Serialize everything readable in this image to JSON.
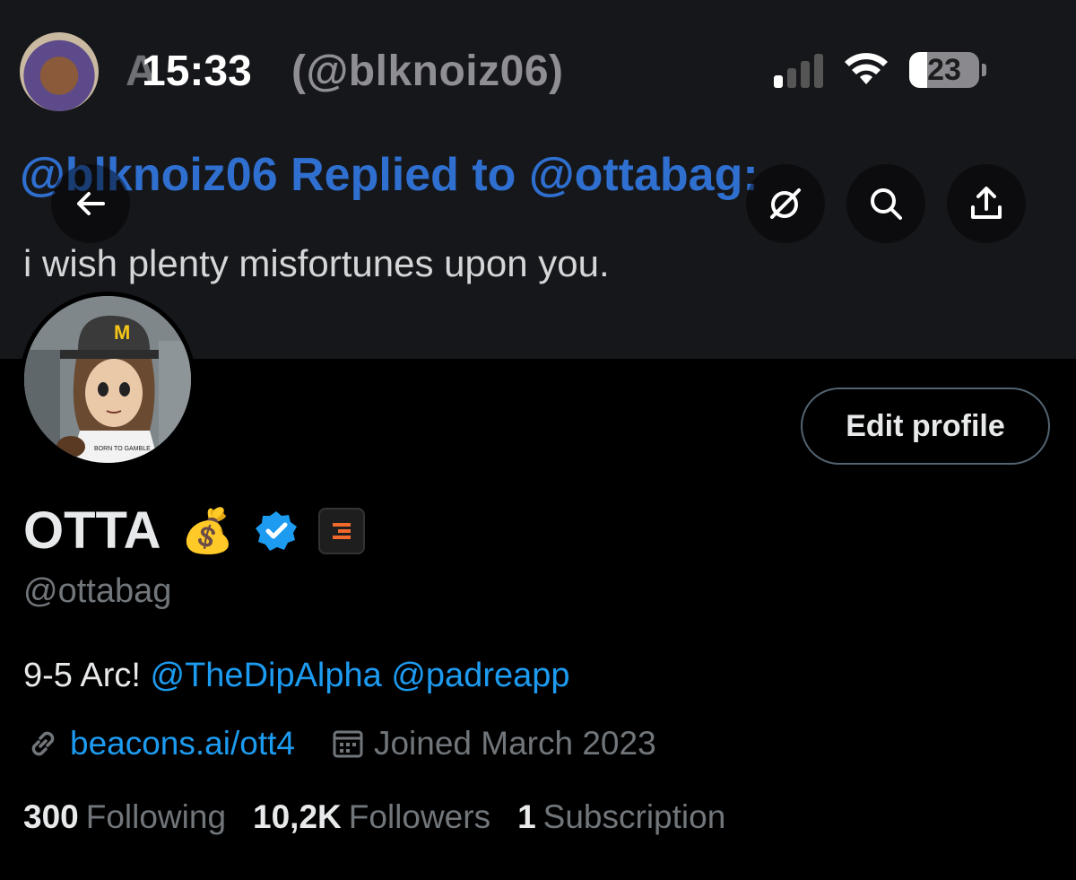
{
  "banner": {
    "title_ghost": "A",
    "title_handle": "(@blknoiz06)",
    "reply_line": "@blknoiz06 Replied to @ottabag:",
    "reply_text": "i wish plenty misfortunes upon you."
  },
  "status_bar": {
    "time": "15:33",
    "battery": "23",
    "signal_bars_on": 1,
    "signal_bars_total": 4
  },
  "icons": {
    "back": "arrow-left-icon",
    "grok": "grok-icon",
    "search": "search-icon",
    "share": "share-icon",
    "link": "link-icon",
    "calendar": "calendar-icon",
    "verified": "verified-badge-icon",
    "moneybag": "💰"
  },
  "profile": {
    "edit_label": "Edit profile",
    "name": "OTTA",
    "handle": "@ottabag",
    "bio_prefix": "9-5 Arc!",
    "bio_mention_1": "@TheDipAlpha",
    "bio_mention_2": "@padreapp",
    "link": "beacons.ai/ott4",
    "joined": "Joined March 2023"
  },
  "stats": {
    "following_count": "300",
    "following_label": "Following",
    "followers_count": "10,2K",
    "followers_label": "Followers",
    "subscription_count": "1",
    "subscription_label": "Subscription"
  },
  "colors": {
    "accent": "#1d9bf0",
    "muted": "#71767b",
    "banner_bg": "#16171a"
  }
}
